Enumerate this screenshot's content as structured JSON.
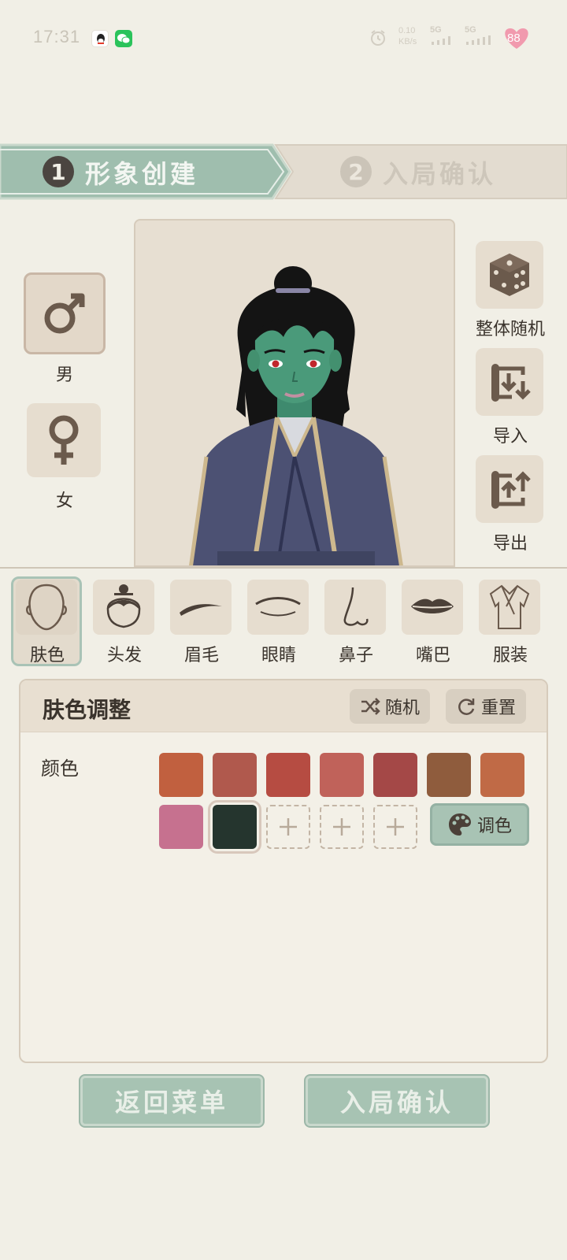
{
  "status_bar": {
    "time": "17:31",
    "net_speed": "0.10",
    "net_unit": "KB/s",
    "sim1": "5G",
    "sim2": "5G",
    "battery": "88"
  },
  "steps": [
    {
      "number": "1",
      "label": "形象创建",
      "active": true
    },
    {
      "number": "2",
      "label": "入局确认",
      "active": false
    }
  ],
  "gender": {
    "male_label": "男",
    "female_label": "女",
    "selected": "male"
  },
  "actions": {
    "random_all": "整体随机",
    "import": "导入",
    "export": "导出"
  },
  "features": [
    {
      "label": "肤色",
      "icon": "face-outline-icon",
      "selected": true
    },
    {
      "label": "头发",
      "icon": "hair-bun-icon",
      "selected": false
    },
    {
      "label": "眉毛",
      "icon": "eyebrow-icon",
      "selected": false
    },
    {
      "label": "眼睛",
      "icon": "eye-icon",
      "selected": false
    },
    {
      "label": "鼻子",
      "icon": "nose-icon",
      "selected": false
    },
    {
      "label": "嘴巴",
      "icon": "lips-icon",
      "selected": false
    },
    {
      "label": "服装",
      "icon": "robe-icon",
      "selected": false
    }
  ],
  "panel": {
    "title": "肤色调整",
    "random_label": "随机",
    "reset_label": "重置",
    "color_label": "颜色",
    "mix_label": "调色",
    "swatches_row1": [
      "#c1603f",
      "#b0594d",
      "#b64c42",
      "#c0625a",
      "#a44847",
      "#8f5c3d",
      "#c06a46"
    ],
    "swatches_row2": [
      "#c6718f",
      "#25352e"
    ],
    "selected_swatch": "#25352e",
    "empty_slots": 3
  },
  "bottom": {
    "back_label": "返回菜单",
    "confirm_label": "入局确认"
  },
  "colors": {
    "accent_green": "#9fbeae",
    "background": "#f1efe6",
    "icon_brown": "#6b5a4c"
  }
}
